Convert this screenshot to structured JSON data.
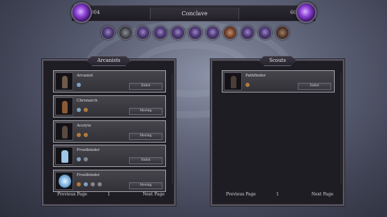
{
  "topbar": {
    "left_value": "98904",
    "title": "Conclave",
    "right_value": "6637"
  },
  "hero_icons": [
    "arcane-icon",
    "spectre-icon",
    "mage-icon",
    "warlock-icon",
    "sorcerer-icon",
    "knight-icon",
    "shade-icon",
    "fire-mage-icon",
    "veil-icon",
    "star-icon",
    "bear-icon"
  ],
  "left_panel": {
    "title": "Arcanists",
    "units": [
      {
        "name": "Arcanist",
        "button": "Enlist",
        "selected": true
      },
      {
        "name": "Chronarch",
        "button": "Moving",
        "selected": true
      },
      {
        "name": "Acolyte",
        "button": "Moving",
        "selected": true
      },
      {
        "name": "Frostbinder",
        "button": "Enlist",
        "selected": true
      },
      {
        "name": "Frostbinder",
        "button": "Moving",
        "selected": true
      }
    ],
    "pager": {
      "prev": "Previous Page",
      "page": "1",
      "next": "Next Page"
    }
  },
  "right_panel": {
    "title": "Scouts",
    "units": [
      {
        "name": "Pathfinder",
        "button": "Enlist",
        "selected": true
      }
    ],
    "pager": {
      "prev": "Previous Page",
      "page": "1",
      "next": "Next Page"
    }
  },
  "colors": {
    "accent_purple": "#8e43d6",
    "panel_bg": "#1e1d23",
    "border": "#5c5866"
  }
}
